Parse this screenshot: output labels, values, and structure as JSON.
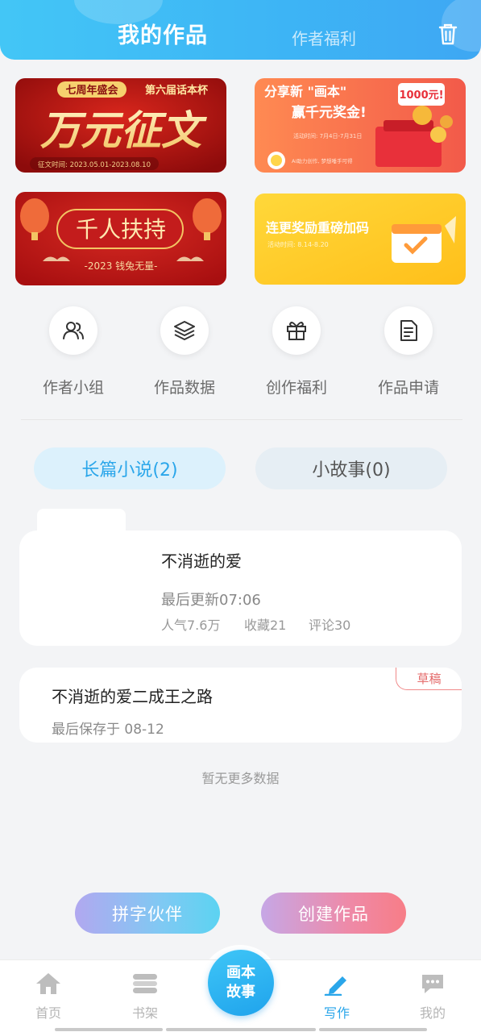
{
  "header": {
    "tab_mine": "我的作品",
    "tab_welfare": "作者福利",
    "trash_icon": "trash-icon"
  },
  "banners": [
    {
      "name": "contest",
      "tag_left": "七周年盛会",
      "tag_right": "第六届话本杯",
      "headline": "万元征文",
      "footnote": "征文时间: 2023.05.01-2023.08.10"
    },
    {
      "name": "share",
      "line1": "分享新 \"画本\"",
      "line2": "赢千元奖金!",
      "badge": "1000元!",
      "footnote": "活动时间: 7月4日-7月31日",
      "footnote2": "AI助力创作, 梦想唾手可得"
    },
    {
      "name": "support",
      "headline": "千人扶持",
      "sub": "-2023 钱兔无量-"
    },
    {
      "name": "update-reward",
      "headline": "连更奖励重磅加码",
      "sub": "活动时间: 8.14-8.20"
    }
  ],
  "quick_actions": [
    {
      "label": "作者小组",
      "icon": "users-icon"
    },
    {
      "label": "作品数据",
      "icon": "layers-icon"
    },
    {
      "label": "创作福利",
      "icon": "gift-icon"
    },
    {
      "label": "作品申请",
      "icon": "document-icon"
    }
  ],
  "categories": {
    "novel": "长篇小说(2)",
    "story": "小故事(0)"
  },
  "works": [
    {
      "title": "不消逝的爱",
      "updated": "最后更新07:06",
      "popularity": "人气7.6万",
      "favorites": "收藏21",
      "comments": "评论30"
    },
    {
      "title": "不消逝的爱二成王之路",
      "saved": "最后保存于 08-12",
      "badge": "草稿"
    }
  ],
  "no_more": "暂无更多数据",
  "actions": {
    "partner": "拼字伙伴",
    "create": "创建作品"
  },
  "nav": {
    "home": "首页",
    "shelf": "书架",
    "center_line1": "画本",
    "center_line2": "故事",
    "write": "写作",
    "mine": "我的"
  },
  "colors": {
    "accent": "#2aa6ea",
    "header_start": "#43c6f6",
    "draft": "#e46a6a"
  }
}
